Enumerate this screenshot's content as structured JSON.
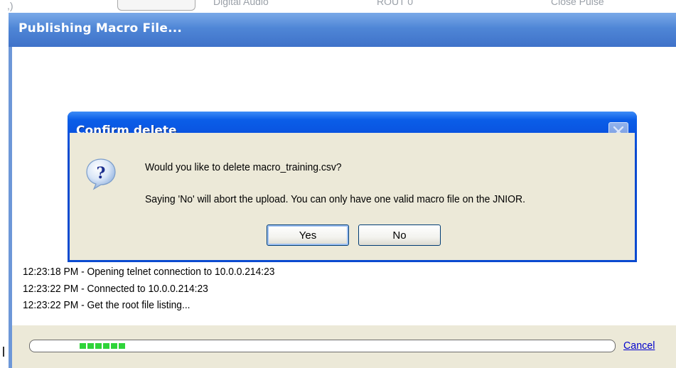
{
  "background": {
    "cell1": "Digital Audio",
    "cell2": "ROUT 0",
    "cell3": "Close Pulse"
  },
  "window": {
    "title": "Publishing Macro File..."
  },
  "dialog": {
    "title": "Confirm delete",
    "message": "Would you like to delete macro_training.csv?",
    "detail": "Saying 'No' will abort the upload.  You can only have one valid macro file on the JNIOR.",
    "yes_label": "Yes",
    "no_label": "No",
    "icon": "question-icon"
  },
  "log": [
    "12:23:18 PM - Opening telnet connection to 10.0.0.214:23",
    "12:23:22 PM - Connected to 10.0.0.214:23",
    "12:23:22 PM - Get the root file listing..."
  ],
  "footer": {
    "cancel_label": "Cancel"
  },
  "colors": {
    "titlebar": "#4f86d6",
    "dialog_titlebar": "#0953e0",
    "dialog_body": "#ece9d8",
    "progress": "#2fd43a",
    "link": "#0000cc"
  }
}
